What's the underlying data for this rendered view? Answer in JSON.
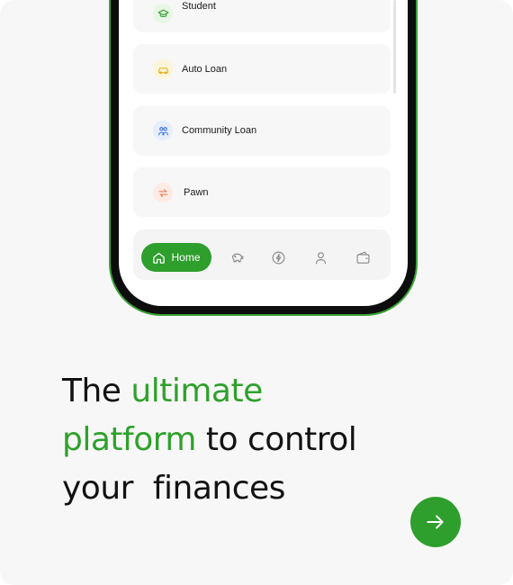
{
  "loans": [
    {
      "label": "Student",
      "icon": "graduation-cap-icon",
      "icon_bg": "#e8f6e6",
      "icon_color": "#2e9e2c"
    },
    {
      "label": "Auto Loan",
      "icon": "car-icon",
      "icon_bg": "#fdf5d9",
      "icon_color": "#e0b21a"
    },
    {
      "label": "Community Loan",
      "icon": "community-icon",
      "icon_bg": "#e6eefc",
      "icon_color": "#3d6fe0"
    },
    {
      "label": "Pawn",
      "icon": "exchange-icon",
      "icon_bg": "#fdebe4",
      "icon_color": "#e8734a"
    }
  ],
  "nav": {
    "home_label": "Home",
    "items": [
      "home-icon",
      "piggy-bank-icon",
      "lightning-icon",
      "user-icon",
      "wallet-icon"
    ]
  },
  "headline": {
    "w1": "The",
    "w2": "ultimate",
    "w3": "platform",
    "w4": "to control",
    "w5": "your  finances"
  },
  "colors": {
    "accent": "#2e9e2c",
    "headline_accent": "#2ea12c",
    "text": "#121212"
  },
  "cta": {
    "icon": "arrow-right-icon"
  }
}
